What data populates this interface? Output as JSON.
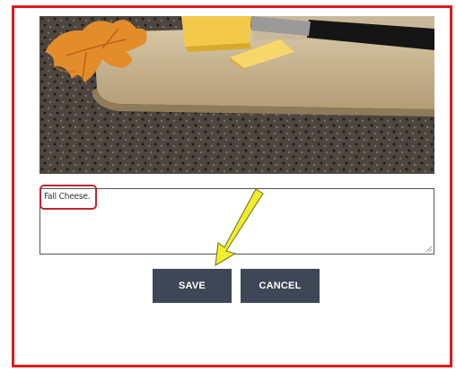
{
  "caption": {
    "value": "Fall Cheese."
  },
  "buttons": {
    "save_label": "SAVE",
    "cancel_label": "CANCEL"
  },
  "colors": {
    "frame_border": "#e3171b",
    "button_bg": "#3d4756",
    "highlight": "#c1272d",
    "arrow": "#f2ee2a"
  },
  "icons": {
    "annotation_arrow": "yellow-arrow-icon",
    "resize": "resize-grip-icon"
  }
}
